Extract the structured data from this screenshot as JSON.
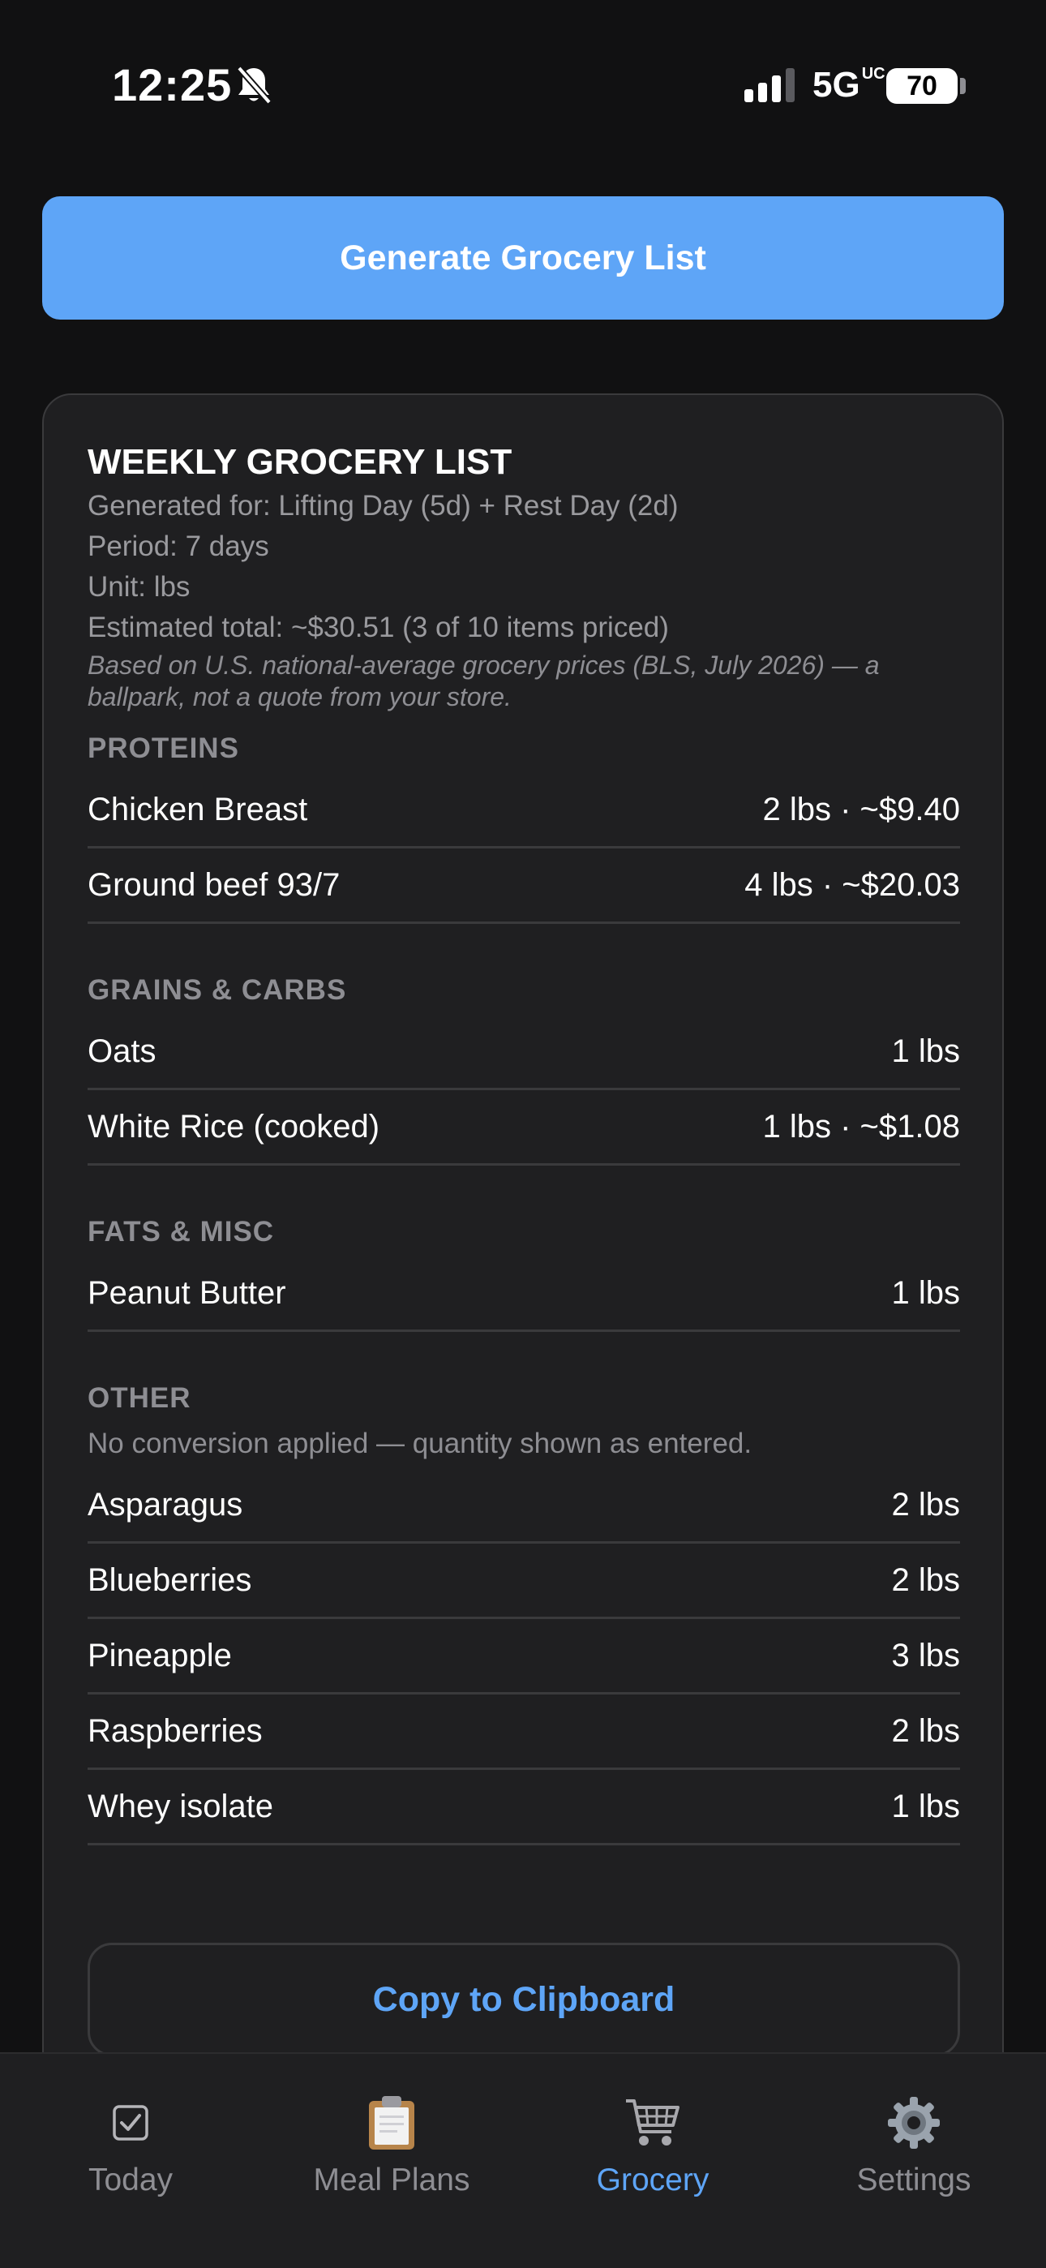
{
  "status": {
    "time": "12:25",
    "network": "5G",
    "network_badge": "UC",
    "battery": "70"
  },
  "actions": {
    "generate_label": "Generate Grocery List",
    "copy_label": "Copy to Clipboard"
  },
  "list": {
    "title": "WEEKLY GROCERY LIST",
    "generated_for": "Generated for: Lifting Day (5d) + Rest Day (2d)",
    "period": "Period: 7 days",
    "unit": "Unit: lbs",
    "estimated_total": "Estimated total: ~$30.51 (3 of 10 items priced)",
    "price_note": "Based on U.S. national-average grocery prices (BLS, July 2026) — a ballpark, not a quote from your store.",
    "sections": [
      {
        "label": "PROTEINS",
        "items": [
          {
            "name": "Chicken Breast",
            "qty": "2 lbs · ~$9.40"
          },
          {
            "name": "Ground beef 93/7",
            "qty": "4 lbs · ~$20.03"
          }
        ]
      },
      {
        "label": "GRAINS & CARBS",
        "items": [
          {
            "name": "Oats",
            "qty": "1 lbs"
          },
          {
            "name": "White Rice (cooked)",
            "qty": "1 lbs · ~$1.08"
          }
        ]
      },
      {
        "label": "FATS & MISC",
        "items": [
          {
            "name": "Peanut Butter",
            "qty": "1 lbs"
          }
        ]
      },
      {
        "label": "OTHER",
        "note": "No conversion applied — quantity shown as entered.",
        "items": [
          {
            "name": "Asparagus",
            "qty": "2 lbs"
          },
          {
            "name": "Blueberries",
            "qty": "2 lbs"
          },
          {
            "name": "Pineapple",
            "qty": "3 lbs"
          },
          {
            "name": "Raspberries",
            "qty": "2 lbs"
          },
          {
            "name": "Whey isolate",
            "qty": "1 lbs"
          }
        ]
      }
    ]
  },
  "tabs": [
    {
      "label": "Today",
      "icon": "checkbox-icon",
      "active": false
    },
    {
      "label": "Meal Plans",
      "icon": "clipboard-icon",
      "active": false
    },
    {
      "label": "Grocery",
      "icon": "shopping-cart-icon",
      "active": true
    },
    {
      "label": "Settings",
      "icon": "gear-icon",
      "active": false
    }
  ],
  "colors": {
    "accent": "#5ea5f7",
    "background": "#111112",
    "card": "#1f1f21",
    "muted_text": "#8e8e93"
  }
}
